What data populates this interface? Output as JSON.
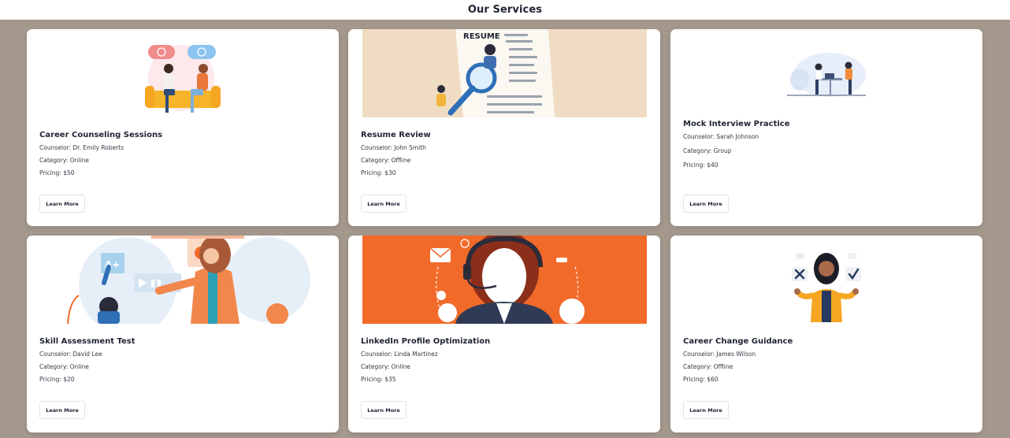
{
  "page": {
    "title": "Our Services"
  },
  "services": [
    {
      "title": "Career Counseling Sessions",
      "counselor": "Counselor: Dr. Emily Roberts",
      "category": "Category: Online",
      "pricing": "Pricing: $50",
      "button": "Learn More"
    },
    {
      "title": "Resume Review",
      "counselor": "Counselor: John Smith",
      "category": "Category: Offline",
      "pricing": "Pricing: $30",
      "button": "Learn More",
      "banner_text": "RESUME"
    },
    {
      "title": "Mock Interview Practice",
      "counselor": "Counselor: Sarah Johnson",
      "category": "Category: Group",
      "pricing": "Pricing: $40",
      "button": "Learn More"
    },
    {
      "title": "Skill Assessment Test",
      "counselor": "Counselor: David Lee",
      "category": "Category: Online",
      "pricing": "Pricing: $20",
      "button": "Learn More",
      "banner_text": "A+"
    },
    {
      "title": "LinkedIn Profile Optimization",
      "counselor": "Counselor: Linda Martinez",
      "category": "Category: Online",
      "pricing": "Pricing: $35",
      "button": "Learn More"
    },
    {
      "title": "Career Change Guidance",
      "counselor": "Counselor: James Wilson",
      "category": "Category: Offline",
      "pricing": "Pricing: $60",
      "button": "Learn More"
    }
  ],
  "colors": {
    "background": "#a4988d",
    "card": "#ffffff",
    "text": "#1f2433",
    "accent_orange": "#f26a2a"
  },
  "icons": [
    "counseling-illustration",
    "resume-illustration",
    "interview-illustration",
    "assessment-illustration",
    "headset-support-illustration",
    "career-change-illustration"
  ]
}
